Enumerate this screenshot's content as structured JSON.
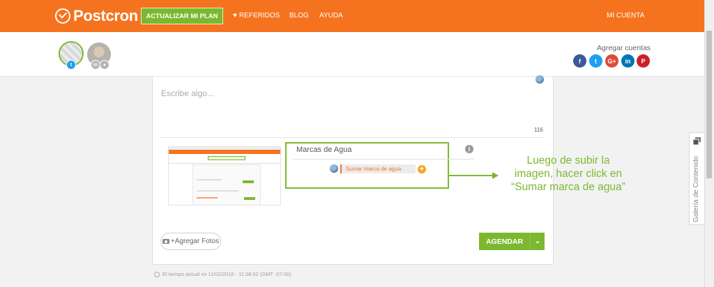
{
  "brand": {
    "name": "Postcron"
  },
  "nav": {
    "plan_button": "ACTUALIZAR MI PLAN",
    "referidos": "REFERIDOS",
    "blog": "BLOG",
    "ayuda": "AYUDA",
    "mi_cuenta": "MI CUENTA"
  },
  "accounts": {
    "add_label": "Agregar cuentas",
    "social_buttons": [
      {
        "icon": "facebook-icon",
        "glyph": "f",
        "color": "#3b5998"
      },
      {
        "icon": "twitter-icon",
        "glyph": "t",
        "color": "#1da1f2"
      },
      {
        "icon": "google-plus-icon",
        "glyph": "G+",
        "color": "#dd4b39"
      },
      {
        "icon": "linkedin-icon",
        "glyph": "in",
        "color": "#0077b5"
      },
      {
        "icon": "pinterest-icon",
        "glyph": "P",
        "color": "#cb2027"
      }
    ]
  },
  "composer": {
    "placeholder": "Escribe algo...",
    "char_count": "116",
    "watermark": {
      "title": "Marcas de Agua",
      "input_placeholder": "Sumar marca de agua"
    },
    "add_photos": "+Agregar Fotos",
    "schedule_button": "AGENDAR",
    "time_note": "El tiempo actual es 11/02/2016 - 11:38:52 (GMT -07:00)"
  },
  "callout": {
    "lines": [
      "Luego de subir la",
      "imagen, hacer click en",
      "“Sumar marca de agua”"
    ]
  },
  "side_tab": {
    "label": "Galería de Contenido"
  },
  "colors": {
    "orange": "#f5731f",
    "green": "#7cb82f"
  }
}
